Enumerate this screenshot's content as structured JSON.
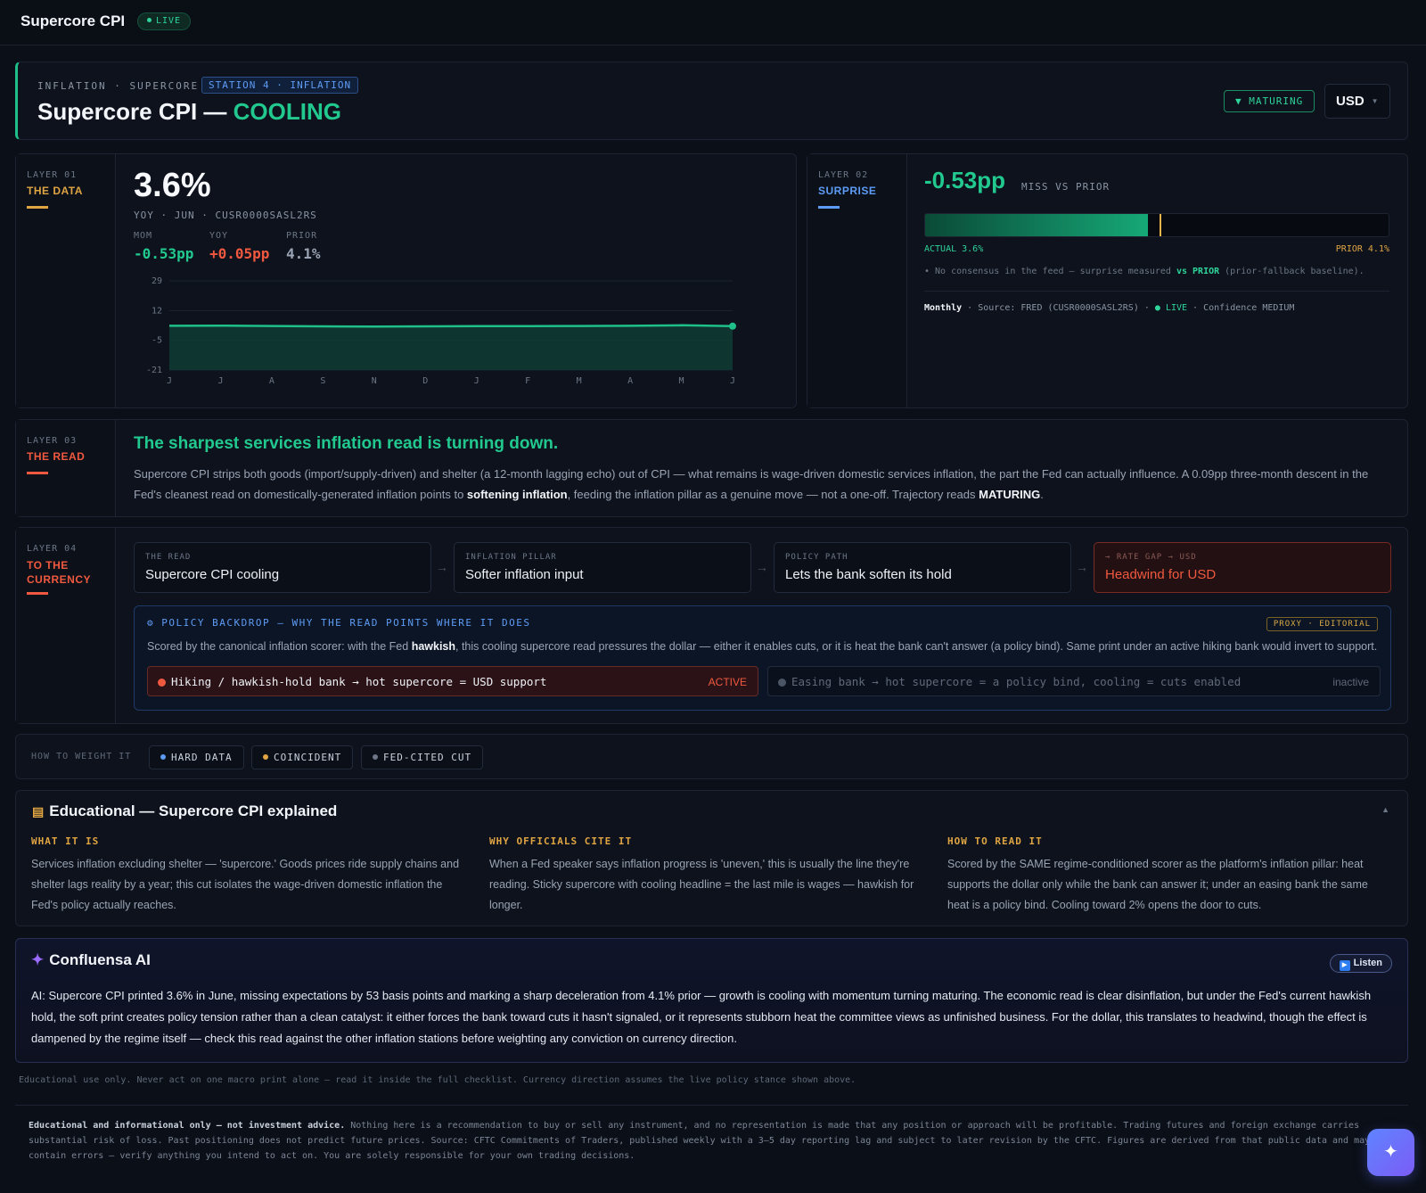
{
  "app": {
    "title": "Supercore CPI",
    "live_label": "LIVE"
  },
  "hero": {
    "kicker": "INFLATION · SUPERCORE",
    "station": "STATION 4 · INFLATION",
    "title_main": "Supercore CPI — ",
    "title_accent": "COOLING",
    "trajectory": "▼ MATURING",
    "currency": "USD",
    "currency_caret": "▼"
  },
  "layer1": {
    "tag": "LAYER 01",
    "name": "THE DATA",
    "value": "3.6%",
    "sub": "YOY · JUN · CUSR0000SASL2RS",
    "metrics": [
      {
        "label": "MOM",
        "value": "-0.53pp",
        "color": "#22c98f"
      },
      {
        "label": "YOY",
        "value": "+0.05pp",
        "color": "#f0593f"
      },
      {
        "label": "PRIOR",
        "value": "4.1%",
        "color": "#9aa4b4"
      }
    ]
  },
  "chart_data": {
    "type": "area",
    "categories": [
      "J",
      "J",
      "A",
      "S",
      "N",
      "D",
      "J",
      "F",
      "M",
      "A",
      "M",
      "J"
    ],
    "values": [
      3.8,
      3.9,
      3.7,
      3.5,
      3.4,
      3.5,
      3.6,
      3.6,
      3.7,
      3.8,
      4.1,
      3.6
    ],
    "y_ticks": [
      "29",
      "12",
      "-5",
      "-21"
    ],
    "ylim": [
      -21,
      29
    ],
    "grid": true,
    "series_color": "#1fbf8a"
  },
  "layer2": {
    "tag": "LAYER 02",
    "name": "SURPRISE",
    "miss_value": "-0.53pp",
    "miss_label": "MISS VS PRIOR",
    "actual_fraction": 0.48,
    "prior_fraction": 0.505,
    "actual_label": "ACTUAL 3.6%",
    "prior_label": "PRIOR 4.1%",
    "note_a": "• No consensus in the feed — surprise measured ",
    "note_b": "vs PRIOR",
    "note_c": " (prior-fallback baseline).",
    "freq": "Monthly",
    "source": " · Source: FRED (CUSR0000SASL2RS) · ",
    "live": "● LIVE",
    "confidence": " · Confidence MEDIUM"
  },
  "layer3": {
    "tag": "LAYER 03",
    "name": "THE READ",
    "headline": "The sharpest services inflation read is turning down.",
    "body_a": "Supercore CPI strips both goods (import/supply-driven) and shelter (a 12-month lagging echo) out of CPI — what remains is wage-driven domestic services inflation, the part the Fed can actually influence. A 0.09pp three-month descent in the Fed's cleanest read on domestically-generated inflation points to ",
    "body_b": "softening inflation",
    "body_c": ", feeding the inflation pillar as a genuine move — not a one-off. Trajectory reads ",
    "body_d": "MATURING",
    "body_e": "."
  },
  "layer4": {
    "tag": "LAYER 04",
    "name": "TO THE CURRENCY",
    "chain": [
      {
        "k": "THE READ",
        "v": "Supercore CPI cooling"
      },
      {
        "k": "INFLATION PILLAR",
        "v": "Softer inflation input"
      },
      {
        "k": "POLICY PATH",
        "v": "Lets the bank soften its hold"
      },
      {
        "k": "→ RATE GAP → USD",
        "v": "Headwind for USD"
      }
    ],
    "arrow": "→",
    "backdrop_title": "⚙ POLICY BACKDROP — WHY THE READ POINTS WHERE IT DOES",
    "backdrop_tag": "PROXY · EDITORIAL",
    "backdrop_a": "Scored by the canonical inflation scorer: with the Fed ",
    "backdrop_b": "hawkish",
    "backdrop_c": ", this cooling supercore read pressures the dollar — either it enables cuts, or it is heat the bank can't answer (a policy bind). Same print under an active hiking bank would invert to support.",
    "regimes": [
      {
        "text": "Hiking / hawkish-hold bank → hot supercore = USD support",
        "state": "ACTIVE"
      },
      {
        "text": "Easing bank → hot supercore = a policy bind, cooling = cuts enabled",
        "state": "inactive"
      }
    ]
  },
  "weight": {
    "label": "HOW TO WEIGHT IT",
    "chips": [
      {
        "label": "HARD DATA",
        "color": "#5d9cf5"
      },
      {
        "label": "COINCIDENT",
        "color": "#e0a543"
      },
      {
        "label": "FED-CITED CUT",
        "color": "#6d7787"
      }
    ]
  },
  "edu": {
    "title": "Educational — Supercore CPI explained",
    "caret": "▲",
    "cols": [
      {
        "k": "WHAT IT IS",
        "v": "Services inflation excluding shelter — 'supercore.' Goods prices ride supply chains and shelter lags reality by a year; this cut isolates the wage-driven domestic inflation the Fed's policy actually reaches."
      },
      {
        "k": "WHY OFFICIALS CITE IT",
        "v": "When a Fed speaker says inflation progress is 'uneven,' this is usually the line they're reading. Sticky supercore with cooling headline = the last mile is wages — hawkish for longer."
      },
      {
        "k": "HOW TO READ IT",
        "v": "Scored by the SAME regime-conditioned scorer as the platform's inflation pillar: heat supports the dollar only while the bank can answer it; under an easing bank the same heat is a policy bind. Cooling toward 2% opens the door to cuts."
      }
    ]
  },
  "ai": {
    "title": "Confluensa AI",
    "listen": "Listen",
    "body": "AI: Supercore CPI printed 3.6% in June, missing expectations by 53 basis points and marking a sharp deceleration from 4.1% prior — growth is cooling with momentum turning maturing. The economic read is clear disinflation, but under the Fed's current hawkish hold, the soft print creates policy tension rather than a clean catalyst: it either forces the bank toward cuts it hasn't signaled, or it represents stubborn heat the committee views as unfinished business. For the dollar, this translates to headwind, though the effect is dampened by the regime itself — check this read against the other inflation stations before weighting any conviction on currency direction."
  },
  "footer": {
    "disclaimer": "Educational use only. Never act on one macro print alone — read it inside the full checklist. Currency direction assumes the live policy stance shown above.",
    "legal_bold": "Educational and informational only — not investment advice.",
    "legal": " Nothing here is a recommendation to buy or sell any instrument, and no representation is made that any position or approach will be profitable. Trading futures and foreign exchange carries substantial risk of loss. Past positioning does not predict future prices. Source: CFTC Commitments of Traders, published weekly with a 3–5 day reporting lag and subject to later revision by the CFTC. Figures are derived from that public data and may contain errors — verify anything you intend to act on. You are solely responsible for your own trading decisions."
  },
  "colors": {
    "accent": "#22c98f",
    "danger": "#f0593f",
    "info": "#5d9cf5",
    "warn": "#e0a543"
  }
}
